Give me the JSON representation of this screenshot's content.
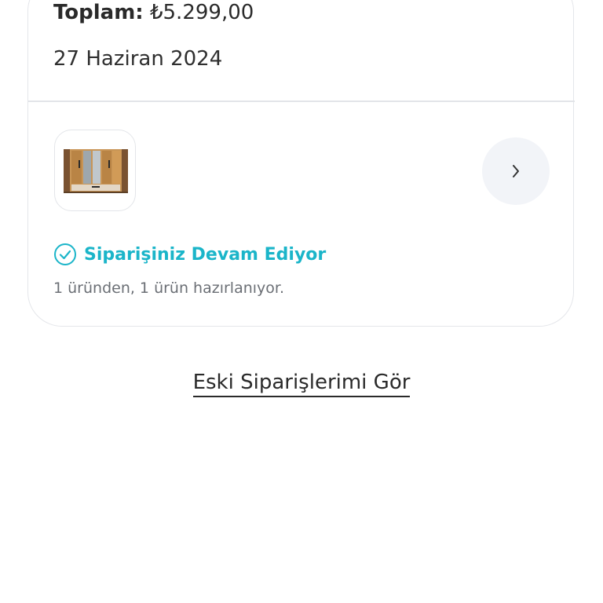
{
  "order": {
    "total_label": "Toplam:",
    "total_value": "₺5.299,00",
    "date": "27 Haziran 2024",
    "product_image": "wardrobe-product-image",
    "status": {
      "icon": "check-circle-icon",
      "text": "Siparişiniz Devam Ediyor",
      "detail": "1 üründen, 1 ürün hazırlanıyor.",
      "color": "#1bb5c9"
    }
  },
  "old_orders_link": "Eski Siparişlerimi Gör"
}
